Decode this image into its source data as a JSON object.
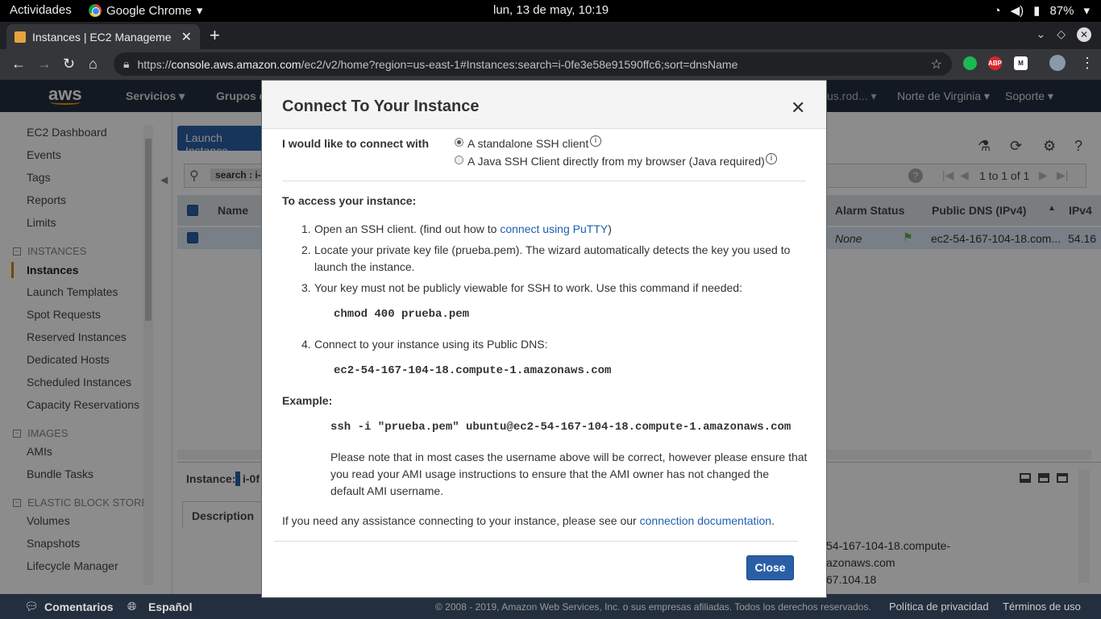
{
  "os": {
    "activities": "Actividades",
    "app": "Google Chrome",
    "clock": "lun, 13 de may, 10:19",
    "battery": "87%"
  },
  "browser": {
    "tab_title": "Instances | EC2 Manageme",
    "url_prefix": "https://",
    "url_domain": "console.aws.amazon.com",
    "url_path": "/ec2/v2/home?region=us-east-1#Instances:search=i-0fe3e58e91590ffc6;sort=dnsName",
    "extensions": [
      "ABP"
    ]
  },
  "aws_nav": {
    "logo": "aws",
    "services": "Servicios",
    "groups": "Grupos de",
    "account": "us.rod...",
    "region": "Norte de Virginia",
    "support": "Soporte"
  },
  "sidebar": {
    "items_top": [
      "EC2 Dashboard",
      "Events",
      "Tags",
      "Reports",
      "Limits"
    ],
    "section_instances": "INSTANCES",
    "items_instances": [
      "Instances",
      "Launch Templates",
      "Spot Requests",
      "Reserved Instances",
      "Dedicated Hosts",
      "Scheduled Instances",
      "Capacity Reservations"
    ],
    "section_images": "IMAGES",
    "items_images": [
      "AMIs",
      "Bundle Tasks"
    ],
    "section_ebs": "ELASTIC BLOCK STORE",
    "items_ebs": [
      "Volumes",
      "Snapshots",
      "Lifecycle Manager"
    ]
  },
  "background": {
    "launch_button": "Launch Instance",
    "search_placeholder": "search : i-",
    "pagination": "1 to 1 of 1",
    "columns": [
      "Name",
      "Alarm Status",
      "Public DNS (IPv4)",
      "IPv4"
    ],
    "row": {
      "alarm": "None",
      "dns": "ec2-54-167-104-18.com...",
      "ip": "54.16"
    },
    "instance_label": "Instance:",
    "instance_id": "i-0f",
    "description_tab": "Description",
    "detail_dns_line1": "54-167-104-18.compute-",
    "detail_dns_line2": "azonaws.com",
    "detail_ip": "67.104.18"
  },
  "footer": {
    "feedback": "Comentarios",
    "language": "Español",
    "copyright": "© 2008 - 2019, Amazon Web Services, Inc. o sus empresas afiliadas. Todos los derechos reservados.",
    "privacy": "Política de privacidad",
    "terms": "Términos de uso"
  },
  "modal": {
    "title": "Connect To Your Instance",
    "close_x": "✕",
    "connect_with_label": "I would like to connect with",
    "option_standalone": "A standalone SSH client",
    "option_java": "A Java SSH Client directly from my browser (Java required)",
    "access_heading": "To access your instance:",
    "step1_num": "1.",
    "step1_text": "Open an SSH client. (find out how to",
    "step1_link": "connect using PuTTY",
    "step1_end": ")",
    "step2_num": "2.",
    "step2_line1": "Locate your private key file (prueba.pem). The wizard automatically detects the key you used to",
    "step2_line2": "launch the instance.",
    "step3_num": "3.",
    "step3_text": "Your key must not be publicly viewable for SSH to work. Use this command if needed:",
    "step3_cmd": "chmod 400 prueba.pem",
    "step4_num": "4.",
    "step4_text": "Connect to your instance using its Public DNS:",
    "step4_dns": "ec2-54-167-104-18.compute-1.amazonaws.com",
    "example_label": "Example:",
    "example_cmd": "ssh -i \"prueba.pem\" ubuntu@ec2-54-167-104-18.compute-1.amazonaws.com",
    "note_line1": "Please note that in most cases the username above will be correct, however please ensure that",
    "note_line2": "you read your AMI usage instructions to ensure that the AMI owner has not changed the",
    "note_line3": "default AMI username.",
    "assist_text": "If you need any assistance connecting to your instance, please see our",
    "assist_link": "connection documentation",
    "assist_end": ".",
    "close_button": "Close"
  }
}
